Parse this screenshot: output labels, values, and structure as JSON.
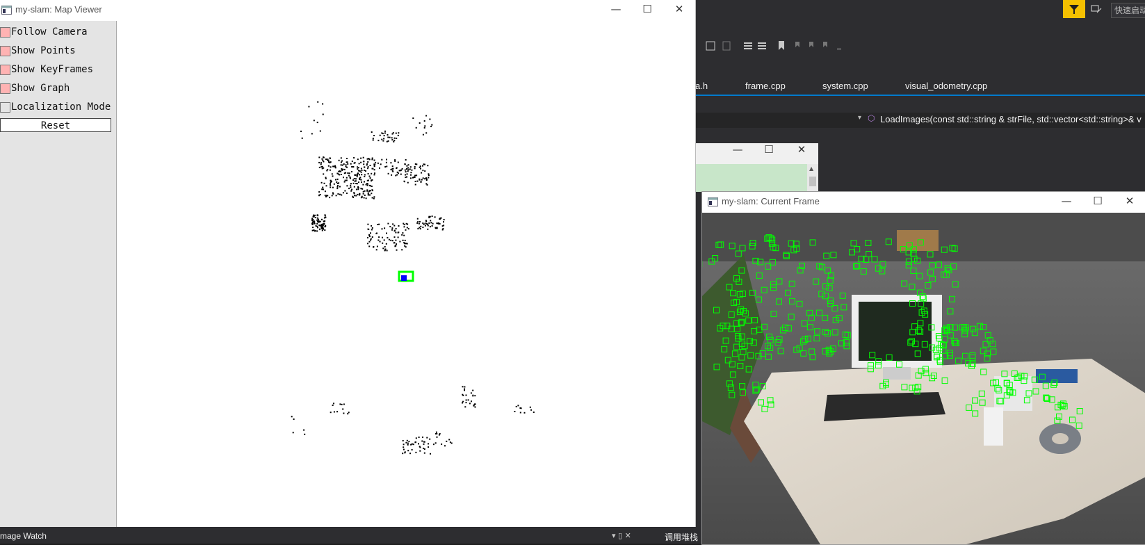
{
  "map_viewer": {
    "title": "my-slam: Map Viewer",
    "controls": {
      "minimize": "—",
      "maximize": "☐",
      "close": "✕"
    },
    "panel": {
      "items": [
        {
          "label": "Follow Camera",
          "checked": true
        },
        {
          "label": "Show Points",
          "checked": true
        },
        {
          "label": "Show KeyFrames",
          "checked": true
        },
        {
          "label": "Show Graph",
          "checked": true
        },
        {
          "label": "Localization Mode",
          "checked": false
        }
      ],
      "reset_label": "Reset"
    },
    "colors": {
      "checked": "#ffb3b3",
      "points": "#000000",
      "keyframe": "#00ff00",
      "camera": "#0000ff"
    }
  },
  "current_frame": {
    "title": "my-slam: Current Frame",
    "controls": {
      "minimize": "—",
      "maximize": "☐",
      "close": "✕"
    },
    "feature_color": "#00ff00"
  },
  "vs": {
    "tabs": [
      "a.h",
      "frame.cpp",
      "system.cpp",
      "visual_odometry.cpp"
    ],
    "nav_function": "LoadImages(const std::string & strFile, std::vector<std::string>& v",
    "quick_launch": "快速启动",
    "bottom_left": "mage Watch",
    "bottom_right": "调用堆栈"
  }
}
